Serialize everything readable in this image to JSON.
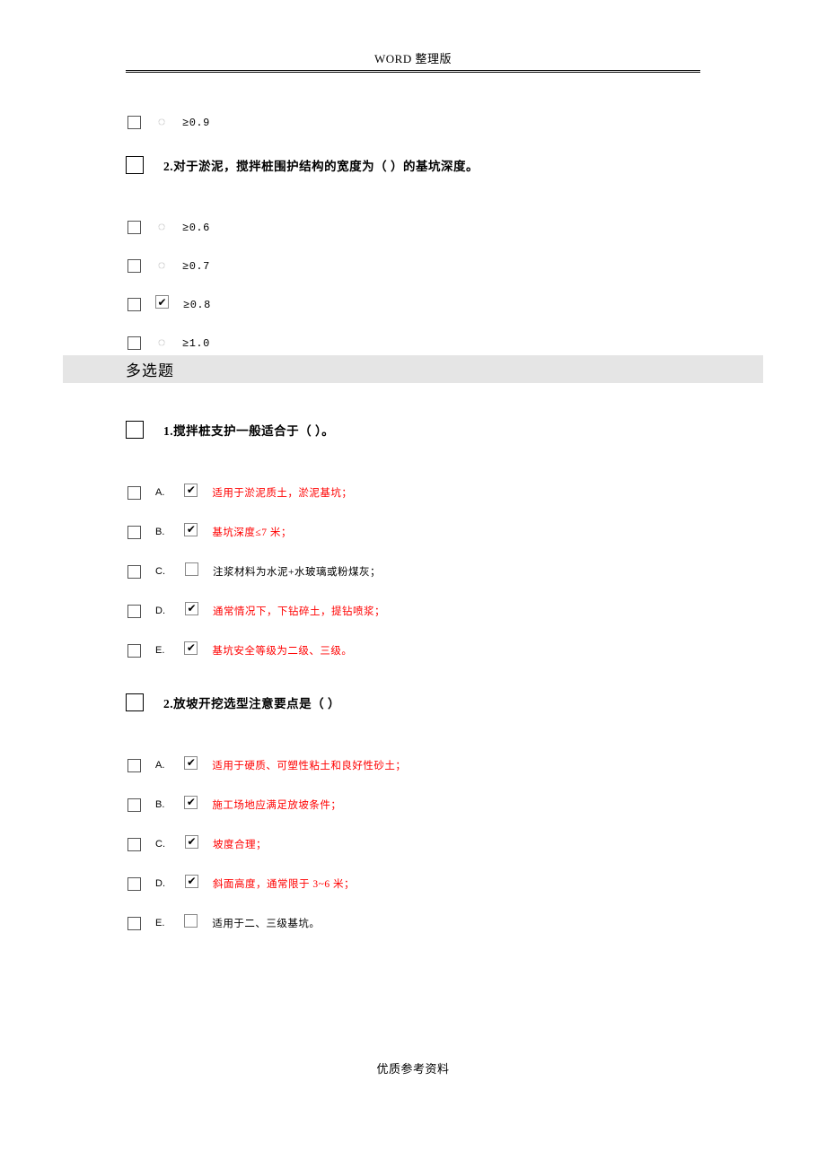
{
  "header": "WORD 整理版",
  "footer": "优质参考资料",
  "section_multi": "多选题",
  "q0": {
    "option": "≥0.9"
  },
  "q2": {
    "stem": "2.对于淤泥，搅拌桩围护结构的宽度为（ ）的基坑深度。",
    "opts": [
      {
        "label": "≥0.6",
        "checked": false
      },
      {
        "label": "≥0.7",
        "checked": false
      },
      {
        "label": "≥0.8",
        "checked": true
      },
      {
        "label": "≥1.0",
        "checked": false
      }
    ]
  },
  "mq1": {
    "stem": "1.搅拌桩支护一般适合于（ ）。",
    "opts": [
      {
        "letter": "A.",
        "label": "适用于淤泥质土，淤泥基坑；",
        "checked": true,
        "red": true
      },
      {
        "letter": "B.",
        "label": "基坑深度≤7 米；",
        "checked": true,
        "red": true
      },
      {
        "letter": "C.",
        "label": "注浆材料为水泥+水玻璃或粉煤灰；",
        "checked": false,
        "red": false
      },
      {
        "letter": "D.",
        "label": "通常情况下，下钻碎土，提钻喷浆；",
        "checked": true,
        "red": true
      },
      {
        "letter": "E.",
        "label": "基坑安全等级为二级、三级。",
        "checked": true,
        "red": true
      }
    ]
  },
  "mq2": {
    "stem": "2.放坡开挖选型注意要点是（ ）",
    "opts": [
      {
        "letter": "A.",
        "label": "适用于硬质、可塑性粘土和良好性砂土；",
        "checked": true,
        "red": true
      },
      {
        "letter": "B.",
        "label": "施工场地应满足放坡条件；",
        "checked": true,
        "red": true
      },
      {
        "letter": "C.",
        "label": "坡度合理；",
        "checked": true,
        "red": true
      },
      {
        "letter": "D.",
        "label": "斜面高度，通常限于 3~6 米；",
        "checked": true,
        "red": true
      },
      {
        "letter": "E.",
        "label": "适用于二、三级基坑。",
        "checked": false,
        "red": false
      }
    ]
  }
}
